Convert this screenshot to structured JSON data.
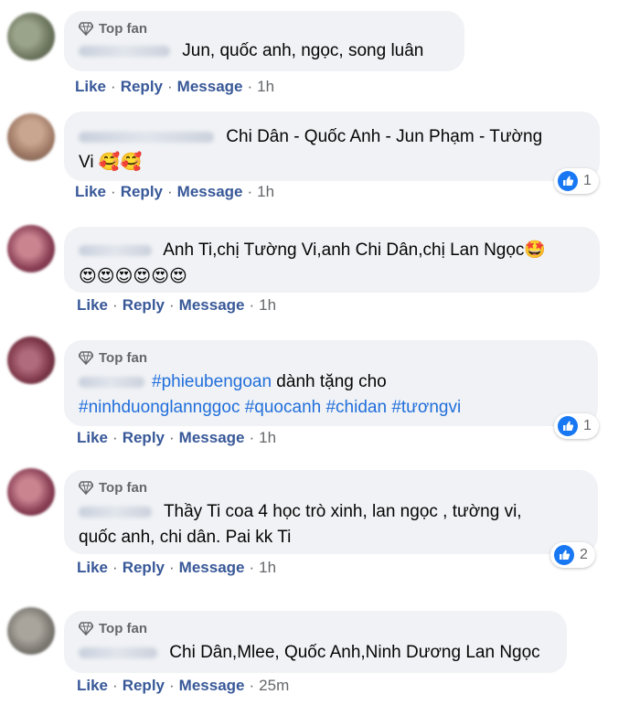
{
  "comments": [
    {
      "top_fan": "Top fan",
      "lines": [
        "Jun, quốc anh, ngọc, song luân"
      ],
      "actions": {
        "like": "Like",
        "reply": "Reply",
        "message": "Message",
        "time": "1h"
      }
    },
    {
      "lines": [
        "Chi Dân - Quốc Anh - Jun Phạm - Tường",
        "Vi 🥰🥰"
      ],
      "reactions": "1",
      "actions": {
        "like": "Like",
        "reply": "Reply",
        "message": "Message",
        "time": "1h"
      }
    },
    {
      "lines": [
        "Anh Ti,chị Tường Vi,anh Chi Dân,chị Lan Ngọc🤩",
        "😍😍😍😍😍😍"
      ],
      "actions": {
        "like": "Like",
        "reply": "Reply",
        "message": "Message",
        "time": "1h"
      }
    },
    {
      "top_fan": "Top fan",
      "hashtag1": "#phieubengoan",
      "text1": " dành tặng cho",
      "hashtags2": [
        "#ninhduonglannggoc",
        "#quocanh",
        "#chidan",
        "#tươngvi"
      ],
      "reactions": "1",
      "actions": {
        "like": "Like",
        "reply": "Reply",
        "message": "Message",
        "time": "1h"
      }
    },
    {
      "top_fan": "Top fan",
      "lines": [
        "Thầy Ti coa 4 học trò xinh, lan ngọc , tường vi,",
        "quốc anh, chi dân. Pai kk Ti"
      ],
      "reactions": "2",
      "actions": {
        "like": "Like",
        "reply": "Reply",
        "message": "Message",
        "time": "1h"
      }
    },
    {
      "top_fan": "Top fan",
      "lines": [
        "Chi Dân,Mlee, Quốc Anh,Ninh Dương Lan Ngọc"
      ],
      "actions": {
        "like": "Like",
        "reply": "Reply",
        "message": "Message",
        "time": "25m"
      }
    }
  ],
  "colors": {
    "bubble": "#f0f2f5",
    "action_link": "#385898",
    "hashtag": "#216fdb",
    "like_blue": "#1877f2"
  }
}
